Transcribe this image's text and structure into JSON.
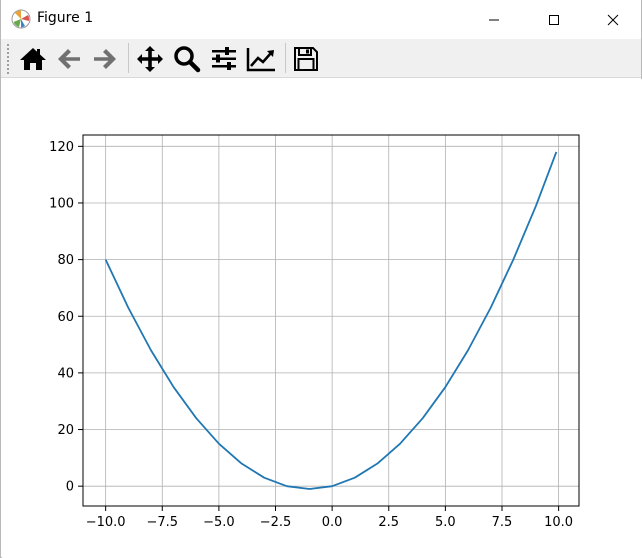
{
  "window": {
    "title": "Figure 1"
  },
  "toolbar": {
    "items": [
      {
        "name": "home-icon"
      },
      {
        "name": "back-arrow-icon"
      },
      {
        "name": "forward-arrow-icon"
      },
      {
        "name": "pan-icon"
      },
      {
        "name": "zoom-icon"
      },
      {
        "name": "subplots-config-icon"
      },
      {
        "name": "edit-axis-icon"
      },
      {
        "name": "save-icon"
      }
    ]
  },
  "chart_data": {
    "type": "line",
    "title": "",
    "xlabel": "",
    "ylabel": "",
    "xlim": [
      -11.0,
      10.9
    ],
    "ylim": [
      -7,
      124
    ],
    "x_ticks": [
      -10.0,
      -7.5,
      -5.0,
      -2.5,
      0.0,
      2.5,
      5.0,
      7.5,
      10.0
    ],
    "x_tick_labels": [
      "−10.0",
      "−7.5",
      "−5.0",
      "−2.5",
      "0.0",
      "2.5",
      "5.0",
      "7.5",
      "10.0"
    ],
    "y_ticks": [
      0,
      20,
      40,
      60,
      80,
      100,
      120
    ],
    "y_tick_labels": [
      "0",
      "20",
      "40",
      "60",
      "80",
      "100",
      "120"
    ],
    "grid": true,
    "color": "#1f77b4",
    "series": [
      {
        "x": [
          -10.0,
          -9.0,
          -8.0,
          -7.0,
          -6.0,
          -5.0,
          -4.0,
          -3.0,
          -2.0,
          -1.0,
          0.0,
          1.0,
          2.0,
          3.0,
          4.0,
          5.0,
          6.0,
          7.0,
          8.0,
          9.0,
          9.9
        ],
        "y": [
          80,
          63,
          48,
          35,
          24,
          15,
          8,
          3,
          0,
          -1,
          0,
          3,
          8,
          15,
          24,
          35,
          48,
          63,
          80,
          99,
          118
        ]
      }
    ]
  }
}
